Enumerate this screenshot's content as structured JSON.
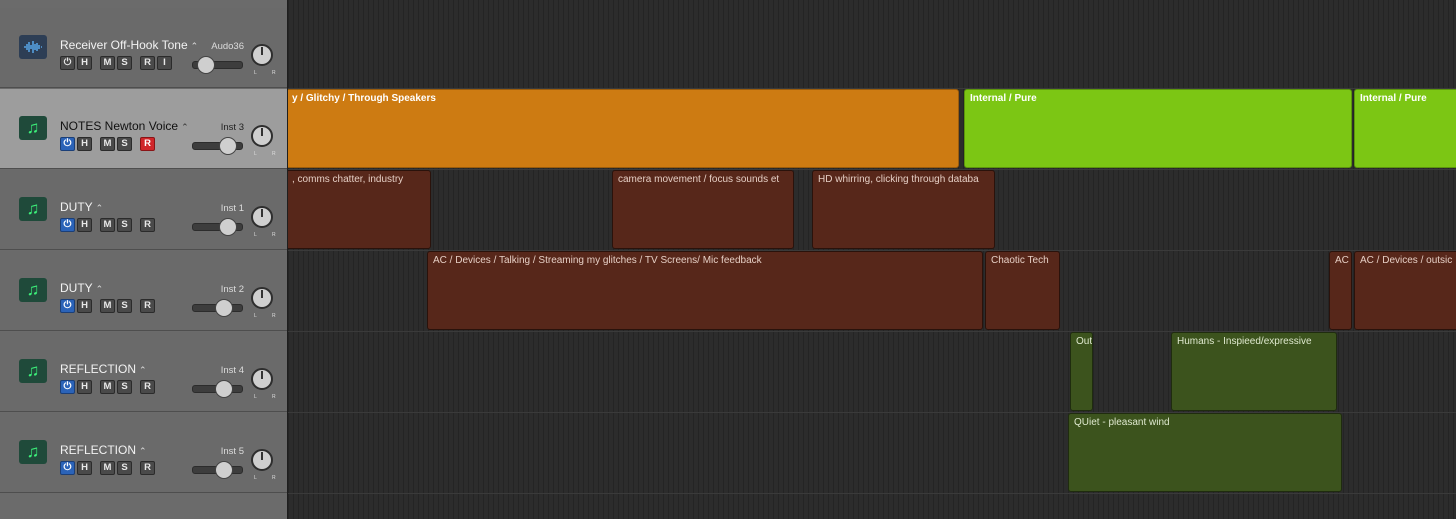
{
  "tracks": [
    {
      "name": "Receiver Off-Hook Tone",
      "instrument": "Audo36",
      "icon": "waveform-icon",
      "buttons": [
        "⏻",
        "H",
        "M",
        "S",
        "R",
        "I"
      ],
      "record_on": false,
      "selected": false
    },
    {
      "name": "NOTES Newton Voice",
      "instrument": "Inst 3",
      "icon": "music-note-icon",
      "buttons": [
        "⏻",
        "H",
        "M",
        "S",
        "R"
      ],
      "record_on": true,
      "selected": true
    },
    {
      "name": "DUTY",
      "instrument": "Inst 1",
      "icon": "music-note-icon",
      "buttons": [
        "⏻",
        "H",
        "M",
        "S",
        "R"
      ],
      "record_on": false,
      "selected": false
    },
    {
      "name": "DUTY",
      "instrument": "Inst 2",
      "icon": "music-note-icon",
      "buttons": [
        "⏻",
        "H",
        "M",
        "S",
        "R"
      ],
      "record_on": false,
      "selected": false
    },
    {
      "name": "REFLECTION",
      "instrument": "Inst 4",
      "icon": "music-note-icon",
      "buttons": [
        "⏻",
        "H",
        "M",
        "S",
        "R"
      ],
      "record_on": false,
      "selected": false
    },
    {
      "name": "REFLECTION",
      "instrument": "Inst 5",
      "icon": "music-note-icon",
      "buttons": [
        "⏻",
        "H",
        "M",
        "S",
        "R"
      ],
      "record_on": false,
      "selected": false
    }
  ],
  "pan_labels": "L R",
  "regions": {
    "r1": "y / Glitchy / Through Speakers",
    "r2": "Internal / Pure",
    "r3": "Internal / Pure",
    "r4": ", comms chatter, industry",
    "r5": "camera movement / focus sounds et",
    "r6": "HD whirring, clicking through databa",
    "r7": "AC / Devices / Talking / Streaming my glitches / TV Screens/ Mic feedback",
    "r8": "Chaotic Tech",
    "r9": "AC",
    "r10": "AC / Devices / outsic",
    "r11": "Out",
    "r12": "Humans - Inspieed/expressive",
    "r13": "QUiet - pleasant wind"
  },
  "colors": {
    "orange": "#cd7b12",
    "lime": "#7cc614",
    "brown": "#57271a",
    "olive": "#3c531d",
    "record": "#d0262a",
    "power": "#2b63b8"
  }
}
